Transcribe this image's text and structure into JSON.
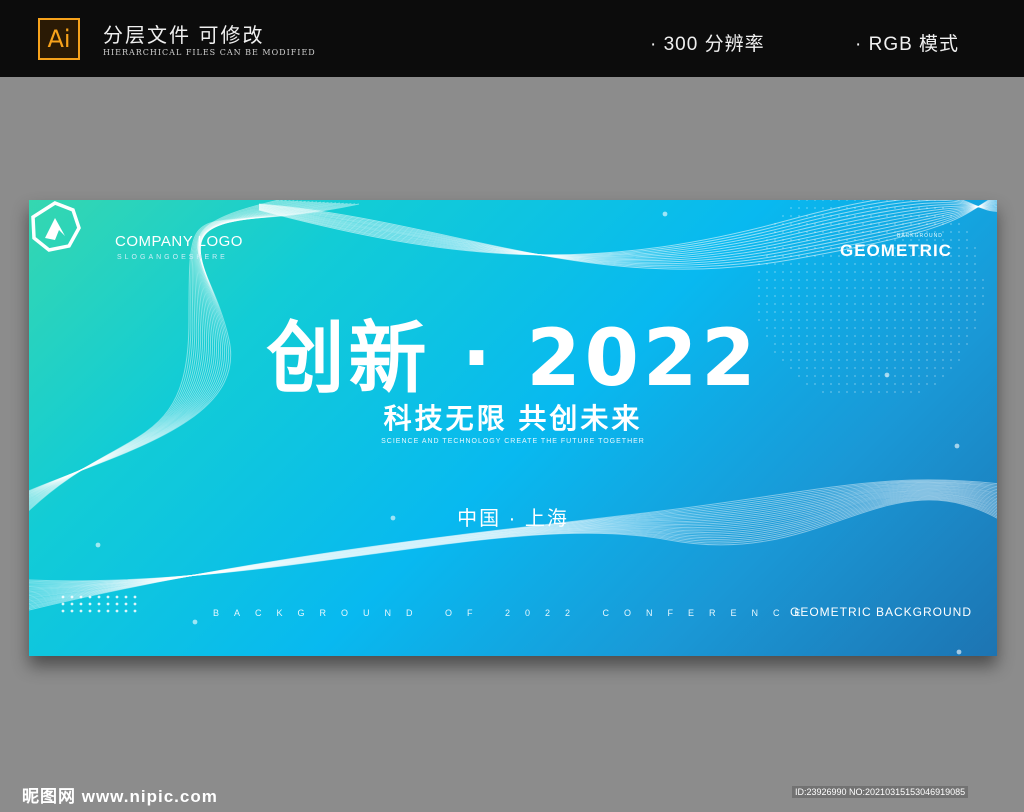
{
  "header": {
    "app_badge": "Ai",
    "title": "分层文件 可修改",
    "subtitle": "HIERARCHICAL FILES CAN BE MODIFIED",
    "resolution": "· 300 分辨率",
    "color_mode": "· RGB 模式"
  },
  "banner": {
    "company_logo": "COMPANY LOGO",
    "slogan": "SLOGANGOESHERE",
    "corner_small": "BACKGROUND",
    "corner_word": "GEOMETRIC",
    "main_title": "创新 · 2022",
    "sub_title": "科技无限 共创未来",
    "english_line": "SCIENCE AND TECHNOLOGY CREATE THE FUTURE TOGETHER",
    "location": "中国 · 上海",
    "bottom_line": "BACKGROUND OF 2022 CONFERENCE",
    "geometric_background": "GEOMETRIC BACKGROUND"
  },
  "footer": {
    "site": "昵图网 www.nipic.com",
    "image_id": "ID:23926990 NO:20210315153046919085"
  },
  "colors": {
    "top_bar": "#0c0c0c",
    "page_bg": "#8c8c8c",
    "badge_orange": "#f7a21b",
    "banner_teal": "#35d7b0",
    "banner_blue": "#08b9f0",
    "banner_deep": "#1d74b2"
  }
}
